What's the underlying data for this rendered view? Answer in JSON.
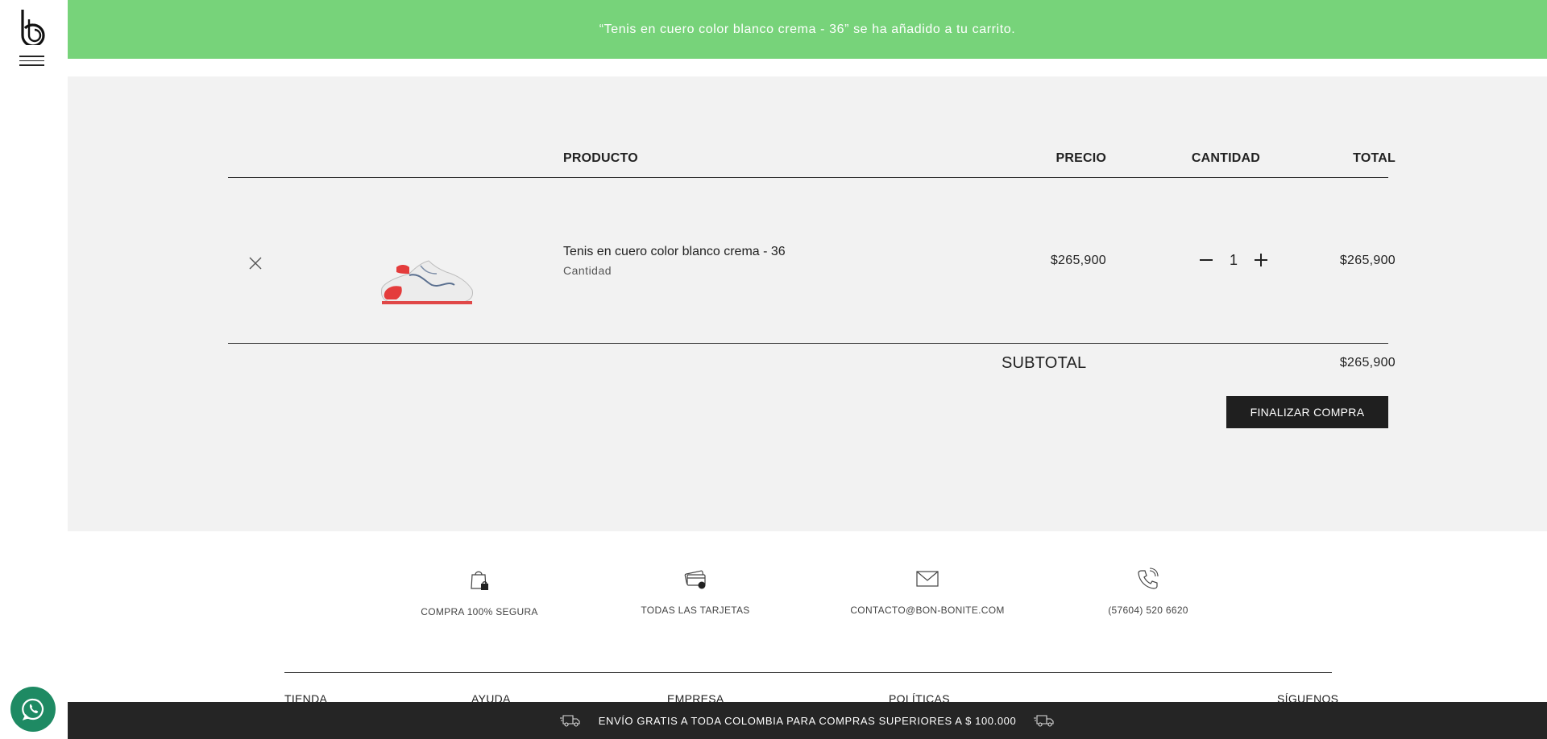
{
  "notice": {
    "message": "“Tenis en cuero color blanco crema - 36” se ha añadido a tu carrito."
  },
  "cart": {
    "headers": {
      "product": "PRODUCTO",
      "price": "PRECIO",
      "quantity": "CANTIDAD",
      "total": "TOTAL"
    },
    "items": [
      {
        "name": "Tenis en cuero color blanco crema - 36",
        "meta": "Cantidad",
        "price": "$265,900",
        "quantity": "1",
        "total": "$265,900"
      }
    ],
    "subtotal_label": "SUBTOTAL",
    "subtotal_value": "$265,900",
    "checkout_label": "FINALIZAR COMPRA"
  },
  "features": [
    {
      "icon": "shopping-bag-lock-icon",
      "label": "COMPRA 100% SEGURA"
    },
    {
      "icon": "credit-cards-icon",
      "label": "TODAS LAS TARJETAS"
    },
    {
      "icon": "envelope-icon",
      "label": "CONTACTO@BON-BONITE.COM"
    },
    {
      "icon": "phone-icon",
      "label": "(57604) 520 6620"
    }
  ],
  "footer": {
    "links": [
      "TIENDA",
      "AYUDA",
      "EMPRESA",
      "POLÍTICAS",
      "SÍGUENOS"
    ]
  },
  "promo": {
    "text": "ENVÍO GRATIS A TODA COLOMBIA PARA COMPRAS SUPERIORES A $ 100.000"
  },
  "colors": {
    "notice_bg": "#77d37a",
    "panel_bg": "#f2f2f2",
    "button_bg": "#1f1f1f",
    "promo_bg": "#252525",
    "whatsapp_bg": "#1e8a63"
  }
}
